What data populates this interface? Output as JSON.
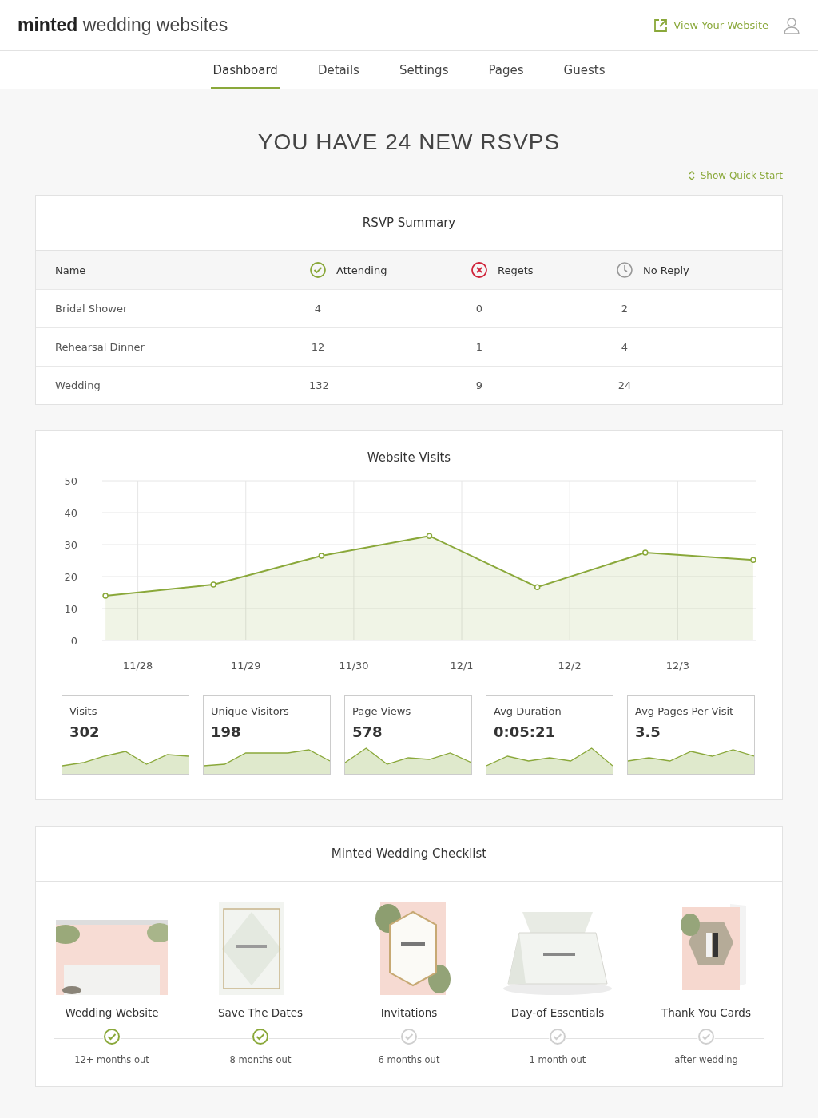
{
  "header": {
    "logo_bold": "minted",
    "logo_rest": "wedding websites",
    "view_link": "View Your Website"
  },
  "tabs": [
    {
      "label": "Dashboard",
      "selected": true
    },
    {
      "label": "Details",
      "selected": false
    },
    {
      "label": "Settings",
      "selected": false
    },
    {
      "label": "Pages",
      "selected": false
    },
    {
      "label": "Guests",
      "selected": false
    }
  ],
  "headline": "YOU HAVE 24 NEW RSVPS",
  "quick_start": "Show Quick Start",
  "rsvp": {
    "title": "RSVP Summary",
    "columns": [
      {
        "label": "Name",
        "kind": "name"
      },
      {
        "label": "Attending",
        "kind": "attending"
      },
      {
        "label": "Regets",
        "kind": "regrets"
      },
      {
        "label": "No Reply",
        "kind": "noreply"
      }
    ],
    "rows": [
      [
        "Bridal Shower",
        "4",
        "0",
        "2"
      ],
      [
        "Rehearsal Dinner",
        "12",
        "1",
        "4"
      ],
      [
        "Wedding",
        "132",
        "9",
        "24"
      ]
    ]
  },
  "visits": {
    "title": "Website Visits",
    "chart_data": {
      "type": "area",
      "grid": true,
      "categories": [
        "11/28",
        "11/29",
        "11/30",
        "12/1",
        "12/2",
        "12/3",
        null
      ],
      "ylim": [
        0,
        50
      ],
      "yticks": [
        0,
        10,
        20,
        30,
        40,
        50
      ],
      "series": [
        {
          "color": "#8aa83a",
          "values": [
            14,
            17.5,
            26.5,
            32.7,
            16.7,
            27.5,
            25.2
          ]
        }
      ]
    },
    "stats": [
      {
        "label": "Visits",
        "value": "302"
      },
      {
        "label": "Unique Visitors",
        "value": "198"
      },
      {
        "label": "Page Views",
        "value": "578"
      },
      {
        "label": "Avg Duration",
        "value": "0:05:21"
      },
      {
        "label": "Avg Pages Per Visit",
        "value": "3.5"
      }
    ]
  },
  "checklist": {
    "title": "Minted Wedding Checklist",
    "items": [
      {
        "label": "Wedding Website",
        "when": "12+ months out",
        "done": true,
        "kind": "picture"
      },
      {
        "label": "Save The Dates",
        "when": "8 months out",
        "done": true,
        "kind": "picture"
      },
      {
        "label": "Invitations",
        "when": "6 months out",
        "done": false,
        "kind": "picture"
      },
      {
        "label": "Day-of Essentials",
        "when": "1 month out",
        "done": false,
        "kind": "picture"
      },
      {
        "label": "Thank You Cards",
        "when": "after wedding",
        "done": false,
        "kind": "picture"
      }
    ]
  }
}
